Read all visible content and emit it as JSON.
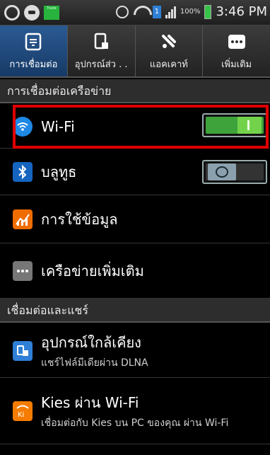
{
  "status_bar": {
    "trade_badge": "Trade",
    "sim_badge": "1",
    "battery_percent": "100%",
    "time": "3:46 PM"
  },
  "tabs": [
    {
      "label": "การเชื่อมต่อ",
      "icon": "connections-icon",
      "active": true
    },
    {
      "label": "อุปกรณ์ส่ว . .",
      "icon": "device-icon",
      "active": false
    },
    {
      "label": "แอคเคาท์",
      "icon": "accounts-icon",
      "active": false
    },
    {
      "label": "เพิ่มเติม",
      "icon": "more-icon",
      "active": false
    }
  ],
  "sections": {
    "network": "การเชื่อมต่อเครือข่าย",
    "share": "เชื่อมต่อและแชร์"
  },
  "rows": {
    "wifi": {
      "label": "Wi-Fi",
      "toggle": "on"
    },
    "bluetooth": {
      "label": "บลูทูธ",
      "toggle": "off"
    },
    "data_usage": {
      "label": "การใช้ข้อมูล"
    },
    "more_networks": {
      "label": "เครือข่ายเพิ่มเติม"
    },
    "nearby": {
      "label": "อุปกรณ์ใกล้เคียง",
      "sub": "แชร์ไฟล์มีเดียผ่าน DLNA"
    },
    "kies": {
      "label": "Kies ผ่าน Wi-Fi",
      "sub": "เชื่อมต่อกับ Kies บน PC ของคุณ ผ่าน Wi-Fi"
    }
  },
  "colors": {
    "toggle_on": "#3fa33b",
    "highlight": "#e00000",
    "active_tab": "#2b5a93"
  }
}
